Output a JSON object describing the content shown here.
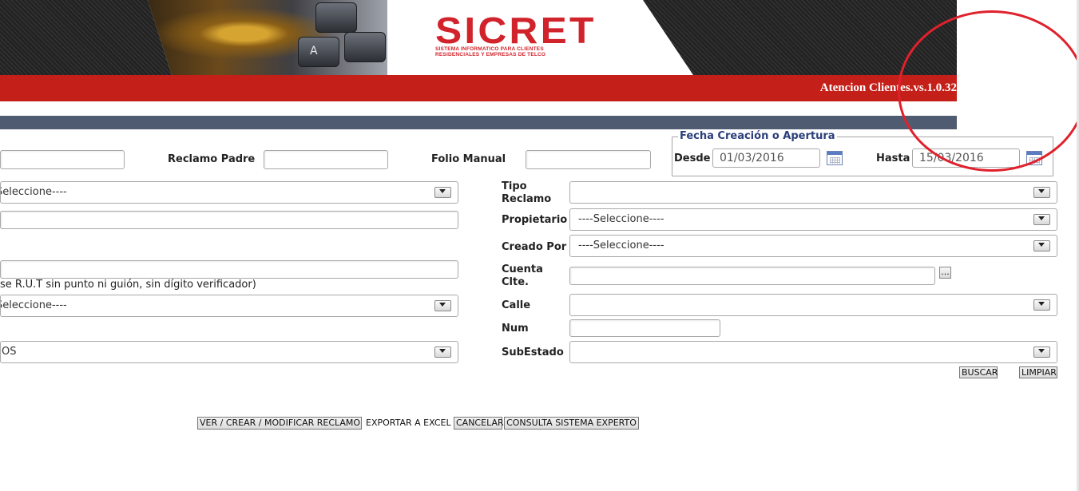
{
  "header": {
    "brand": "SICRET",
    "brand_tagline": "SISTEMA INFORMATICO PARA CLIENTES\nRESIDENCIALES Y EMPRESAS DE TELCO",
    "keyboard_key": "A",
    "version": "Atencion Clientes.vs.1.0.32"
  },
  "filters": {
    "reclamo_padre_label": "Reclamo Padre",
    "folio_manual_label": "Folio Manual",
    "fecha_legend": "Fecha Creación o Apertura",
    "desde_label": "Desde",
    "desde_value": "01/03/2016",
    "hasta_label": "Hasta",
    "hasta_value": "15/03/2016",
    "left_select_1": "Seleccione----",
    "rut_hint": "se R.U.T sin punto ni guión, sin dígito verificador)",
    "left_select_2": "Seleccione----",
    "left_select_3": "OS",
    "tipo_reclamo_label": "Tipo\nReclamo",
    "tipo_reclamo_value": "",
    "propietario_label": "Propietario",
    "propietario_value": "----Seleccione----",
    "creado_por_label": "Creado Por",
    "creado_por_value": "----Seleccione----",
    "cuenta_label": "Cuenta\nClte.",
    "cuenta_button": "...",
    "calle_label": "Calle",
    "calle_value": "",
    "num_label": "Num",
    "subestado_label": "SubEstado",
    "subestado_value": ""
  },
  "actions": {
    "buscar": "BUSCAR",
    "limpiar": "LIMPIAR",
    "ver_crear": "VER / CREAR / MODIFICAR RECLAMO",
    "exportar": "EXPORTAR A EXCEL",
    "cancelar": "CANCELAR",
    "consulta": "CONSULTA SISTEMA EXPERTO"
  },
  "colors": {
    "brand_red": "#c41f18",
    "nav_bar": "#4f5b70",
    "annotation": "#e0212c"
  }
}
